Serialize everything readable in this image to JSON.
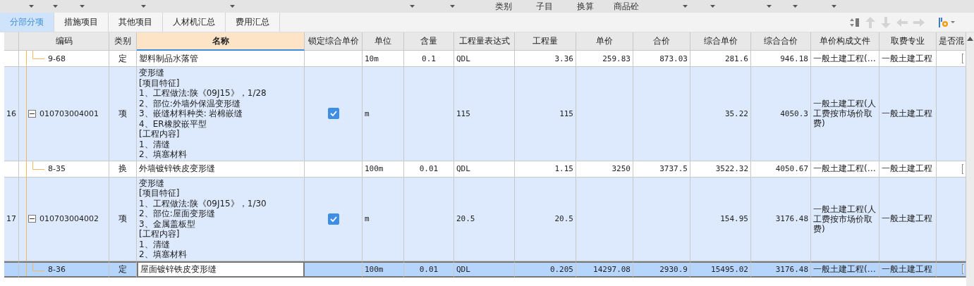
{
  "filter_bar": {
    "labels": [
      "类别",
      "子目",
      "换算",
      "商品砼"
    ]
  },
  "tabs": [
    {
      "label": "分部分项",
      "selected": true
    },
    {
      "label": "措施项目",
      "selected": false
    },
    {
      "label": "其他项目",
      "selected": false
    },
    {
      "label": "人材机汇总",
      "selected": false
    },
    {
      "label": "费用汇总",
      "selected": false
    }
  ],
  "table": {
    "columns": [
      {
        "label": "编码",
        "selected": false
      },
      {
        "label": "类别",
        "selected": false
      },
      {
        "label": "名称",
        "selected": true
      },
      {
        "label": "锁定综合单价",
        "selected": false
      },
      {
        "label": "单位",
        "selected": false
      },
      {
        "label": "含量",
        "selected": false
      },
      {
        "label": "工程量表达式",
        "selected": false
      },
      {
        "label": "工程量",
        "selected": false
      },
      {
        "label": "单价",
        "selected": false
      },
      {
        "label": "合价",
        "selected": false
      },
      {
        "label": "综合单价",
        "selected": false
      },
      {
        "label": "综合合价",
        "selected": false
      },
      {
        "label": "单价构成文件",
        "selected": false
      },
      {
        "label": "取费专业",
        "selected": false
      },
      {
        "label": "是否混",
        "selected": false
      }
    ],
    "rows": [
      {
        "kind": "sub",
        "code": "9-68",
        "type": "定",
        "name": "塑料制品水落管",
        "unit": "10m",
        "content": "0.1",
        "expression": "QDL",
        "quantity": "3.36",
        "unit_price": "259.83",
        "total_price": "873.03",
        "composite_price": "281.6",
        "composite_total": "946.18",
        "price_file": "一般土建工程(…",
        "specialty": "一般土建工程",
        "mixed": false,
        "selected": false
      },
      {
        "kind": "item",
        "number": "16",
        "expanded": true,
        "code": "010703004001",
        "type": "项",
        "name": "变形缝\n[项目特征]\n1、工程做法:陕《09J15》，1/28\n2、部位:外墙外保温变形缝\n3、嵌缝材料种类: 岩棉嵌缝\n4、ER橡胶嵌平型\n[工程内容]\n1、清缝\n2、填塞材料",
        "locked": true,
        "unit": "m",
        "expression": "115",
        "quantity": "115",
        "composite_price": "35.22",
        "composite_total": "4050.3",
        "price_file": "一般土建工程(人工费按市场价取费)",
        "specialty": "一般土建工程",
        "selected": false
      },
      {
        "kind": "sub",
        "code": "8-35",
        "type": "换",
        "name": "外墙镀锌铁皮变形缝",
        "unit": "100m",
        "content": "0.01",
        "expression": "QDL",
        "quantity": "1.15",
        "unit_price": "3250",
        "total_price": "3737.5",
        "composite_price": "3522.32",
        "composite_total": "4050.67",
        "price_file": "一般土建工程(…",
        "specialty": "一般土建工程",
        "mixed": false,
        "selected": false
      },
      {
        "kind": "item",
        "number": "17",
        "expanded": true,
        "code": "010703004002",
        "type": "项",
        "name": "变形缝\n[项目特征]\n1、工程做法:陕《09J15》，1/30\n2、部位:屋面变形缝\n3、金属盖板型\n[工程内容]\n1、清缝\n2、填塞材料",
        "locked": true,
        "unit": "m",
        "expression": "20.5",
        "quantity": "20.5",
        "composite_price": "154.95",
        "composite_total": "3176.48",
        "price_file": "一般土建工程(人工费按市场价取费)",
        "specialty": "一般土建工程",
        "selected": false
      },
      {
        "kind": "sub",
        "code": "8-36",
        "type": "定",
        "name": "屋面镀锌铁皮变形缝",
        "unit": "100m",
        "content": "0.01",
        "expression": "QDL",
        "quantity": "0.205",
        "unit_price": "14297.08",
        "total_price": "2930.9",
        "composite_price": "15495.02",
        "composite_total": "3176.48",
        "price_file": "一般土建工程(…",
        "specialty": "一般土建工程",
        "mixed": false,
        "selected": true
      }
    ]
  }
}
